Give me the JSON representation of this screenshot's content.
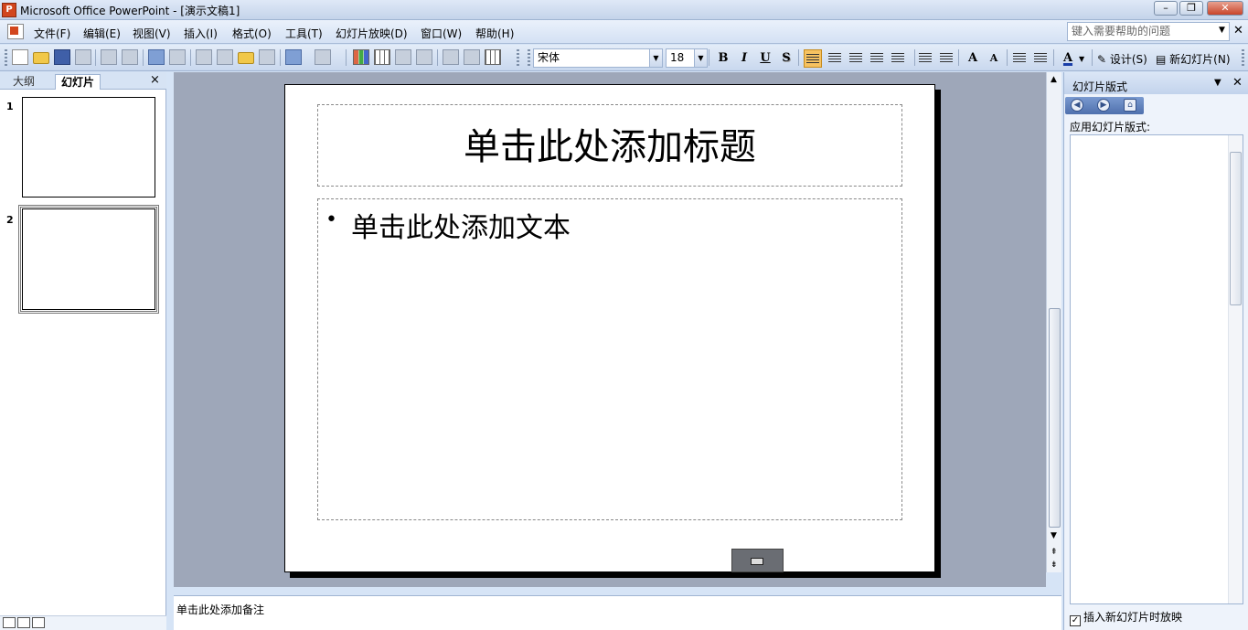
{
  "window": {
    "title": "Microsoft Office PowerPoint - [演示文稿1]",
    "app_icon": "powerpoint-icon"
  },
  "menu": {
    "items": [
      "文件(F)",
      "编辑(E)",
      "视图(V)",
      "插入(I)",
      "格式(O)",
      "工具(T)",
      "幻灯片放映(D)",
      "窗口(W)",
      "帮助(H)"
    ],
    "help_placeholder": "键入需要帮助的问题"
  },
  "toolbar": {
    "font": "宋体",
    "size": "18",
    "bold": "B",
    "italic": "I",
    "underline": "U",
    "shadow": "S",
    "design_label": "设计(S)",
    "new_slide_label": "新幻灯片(N)",
    "active_color": "#f6c261"
  },
  "left_panel": {
    "tab_outline": "大纲",
    "tab_slides": "幻灯片",
    "close": "×",
    "slides": [
      {
        "num": "1"
      },
      {
        "num": "2"
      }
    ],
    "selected_slide": 2
  },
  "slide": {
    "title_placeholder": "单击此处添加标题",
    "body_bullet": "•",
    "body_placeholder": "单击此处添加文本"
  },
  "notes": {
    "placeholder": "单击此处添加备注"
  },
  "task_pane": {
    "title": "幻灯片版式",
    "section_label": "应用幻灯片版式:",
    "checkbox_label": "插入新幻灯片时放映",
    "checkbox_checked": "✓"
  }
}
